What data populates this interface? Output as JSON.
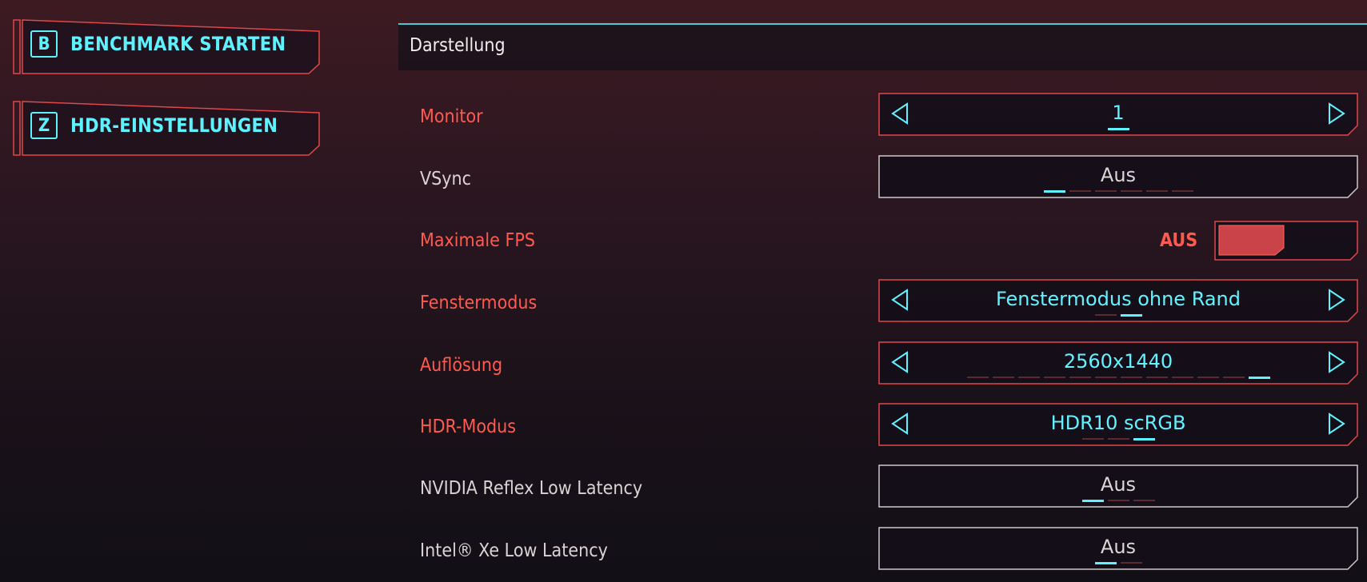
{
  "actions": [
    {
      "key": "B",
      "label": "BENCHMARK STARTEN"
    },
    {
      "key": "Z",
      "label": "HDR-EINSTELLUNGEN"
    }
  ],
  "section": {
    "title": "Darstellung"
  },
  "settings": {
    "monitor": {
      "label": "Monitor",
      "value": "1",
      "option_count": 1,
      "selected_index": 0
    },
    "vsync": {
      "label": "VSync",
      "value": "Aus",
      "option_count": 6,
      "selected_index": 0
    },
    "max_fps": {
      "label": "Maximale FPS",
      "state_text": "AUS",
      "enabled": false
    },
    "window_mode": {
      "label": "Fenstermodus",
      "value": "Fenstermodus ohne Rand",
      "option_count": 2,
      "selected_index": 1
    },
    "resolution": {
      "label": "Auflösung",
      "value": "2560x1440",
      "option_count": 12,
      "selected_index": 11
    },
    "hdr_mode": {
      "label": "HDR-Modus",
      "value": "HDR10 scRGB",
      "option_count": 3,
      "selected_index": 2
    },
    "reflex": {
      "label": "NVIDIA Reflex Low Latency",
      "value": "Aus",
      "option_count": 3,
      "selected_index": 0
    },
    "xell": {
      "label": "Intel® Xe Low Latency",
      "value": "Aus",
      "option_count": 2,
      "selected_index": 0
    }
  },
  "colors": {
    "accent_red": "#ff5a50",
    "accent_cyan": "#5ef2ff",
    "frame_red": "#e0474a",
    "frame_white": "#cfc8c8"
  },
  "icons": {
    "arrow_left": "left-triangle-outline",
    "arrow_right": "right-triangle-outline"
  }
}
